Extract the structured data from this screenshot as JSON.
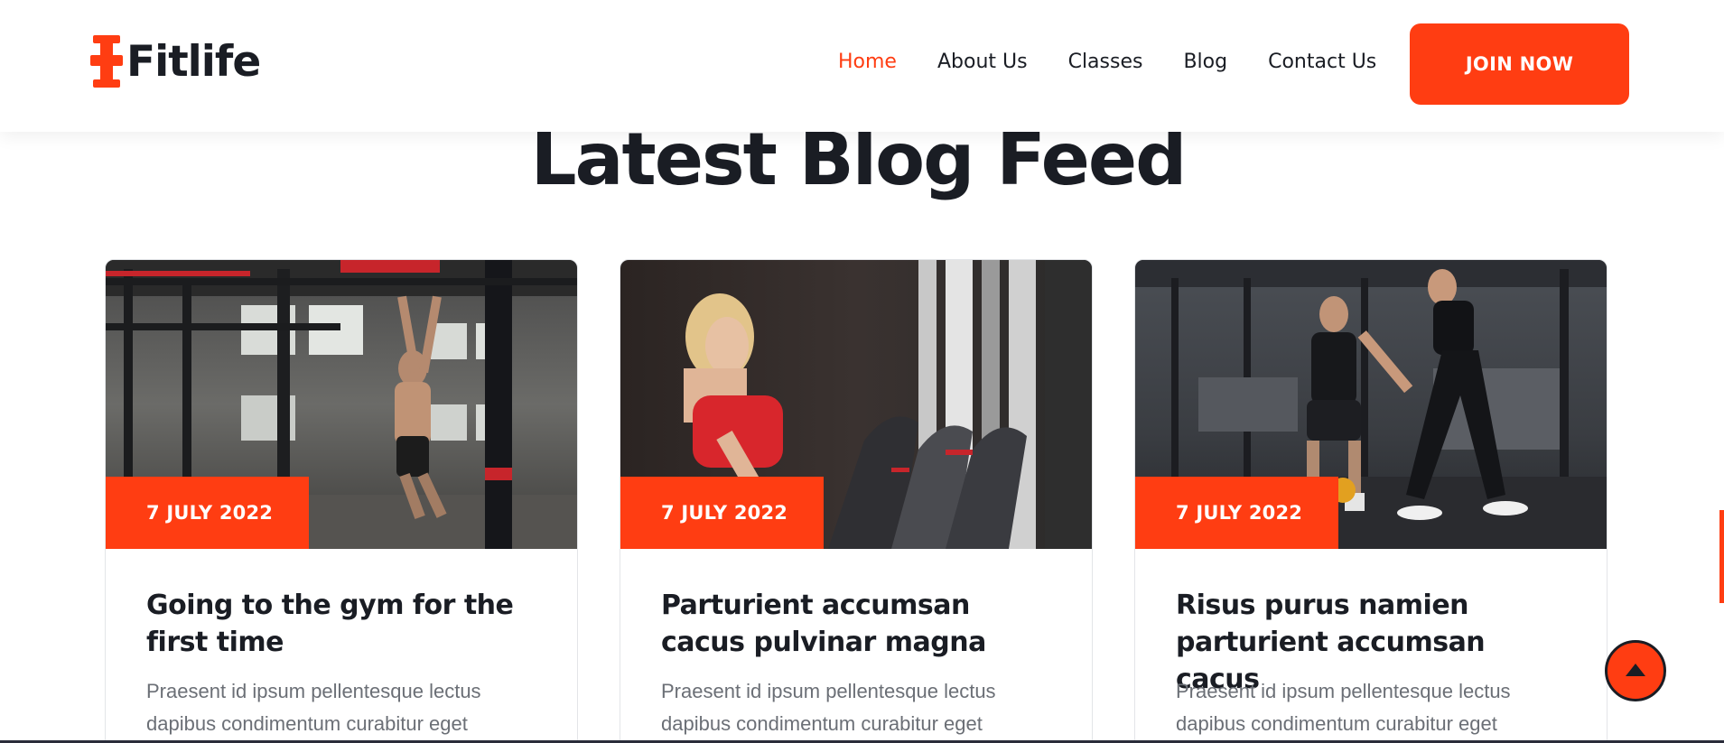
{
  "brand": {
    "name": "Fitlife",
    "accent": "#ff3d12",
    "dark": "#1a1d24"
  },
  "nav": {
    "items": [
      {
        "label": "Home",
        "active": true
      },
      {
        "label": "About Us",
        "active": false
      },
      {
        "label": "Classes",
        "active": false
      },
      {
        "label": "Blog",
        "active": false
      },
      {
        "label": "Contact Us",
        "active": false
      }
    ],
    "cta_label": "JOIN NOW"
  },
  "section": {
    "title": "Latest Blog Feed"
  },
  "posts": [
    {
      "date": "7 JULY 2022",
      "title": "Going to the gym for the first time",
      "excerpt": "Praesent id ipsum pellentesque lectus dapibus condimentum curabitur eget",
      "image": "man-doing-pull-ups-in-gym"
    },
    {
      "date": "7 JULY 2022",
      "title": "Parturient accumsan cacus pulvinar magna",
      "excerpt": "Praesent id ipsum pellentesque lectus dapibus condimentum curabitur eget",
      "image": "woman-running-on-treadmill"
    },
    {
      "date": "7 JULY 2022",
      "title": "Risus purus namien parturient accumsan cacus",
      "excerpt": "Praesent id ipsum pellentesque lectus dapibus condimentum curabitur eget",
      "image": "trainer-and-man-with-kettlebell"
    }
  ],
  "icons": {
    "logo": "dumbbell-icon",
    "scroll_top": "arrow-up-icon"
  }
}
